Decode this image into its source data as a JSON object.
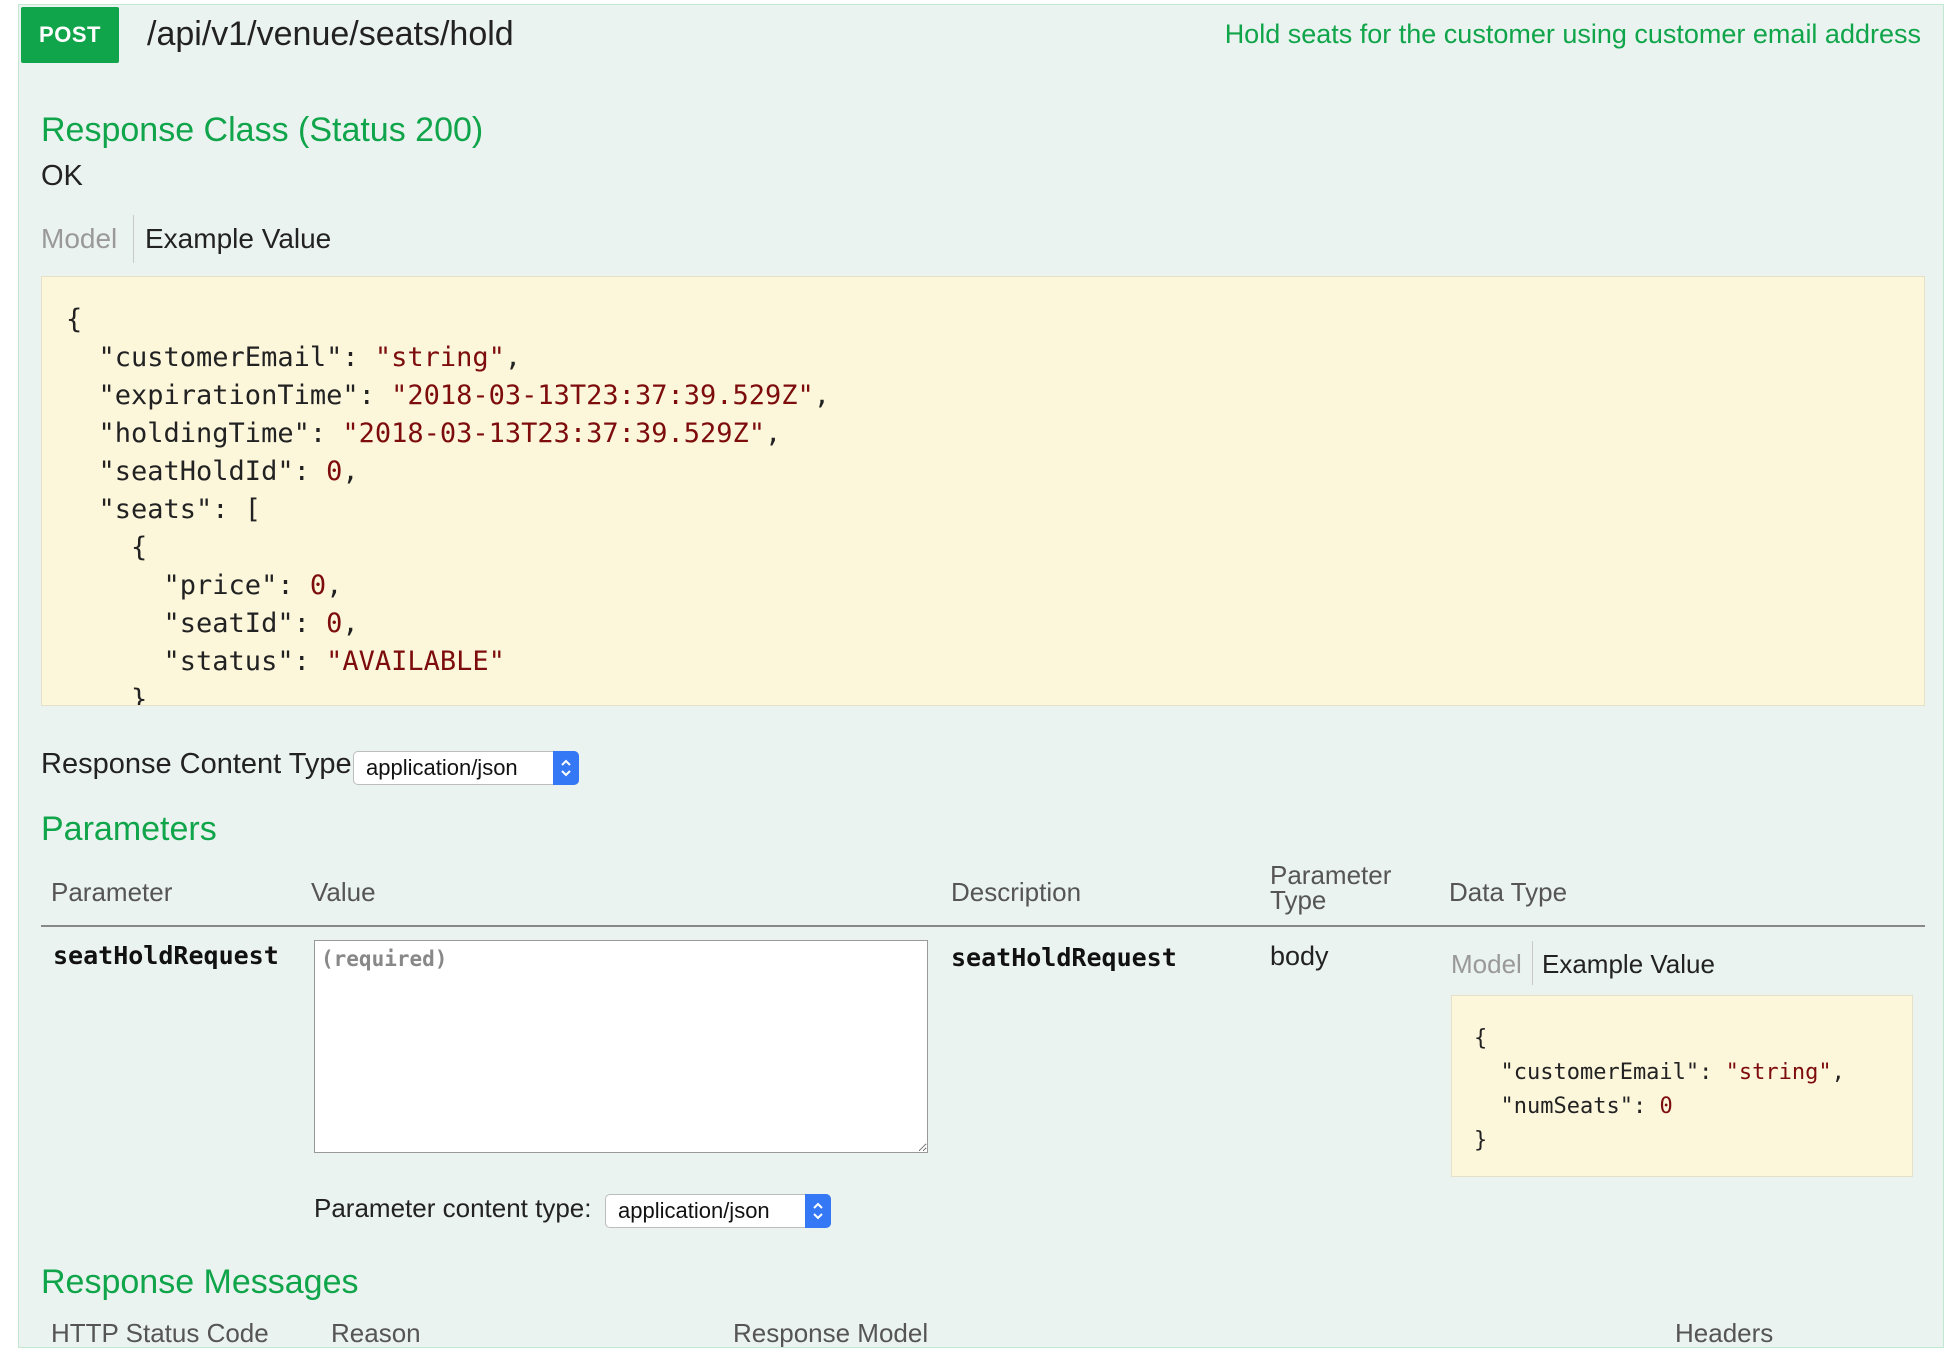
{
  "operation": {
    "method": "POST",
    "path": "/api/v1/venue/seats/hold",
    "summary": "Hold seats for the customer using customer email address"
  },
  "response_class": {
    "heading": "Response Class (Status 200)",
    "status_text": "OK",
    "tabs": {
      "model": "Model",
      "example": "Example Value"
    },
    "example_lines": [
      "{",
      "  \"customerEmail\": \"string\",",
      "  \"expirationTime\": \"2018-03-13T23:37:39.529Z\",",
      "  \"holdingTime\": \"2018-03-13T23:37:39.529Z\",",
      "  \"seatHoldId\": 0,",
      "  \"seats\": [",
      "    {",
      "      \"price\": 0,",
      "      \"seatId\": 0,",
      "      \"status\": \"AVAILABLE\"",
      "    }"
    ]
  },
  "response_content_type": {
    "label": "Response Content Type",
    "selected": "application/json"
  },
  "parameters": {
    "heading": "Parameters",
    "columns": {
      "parameter": "Parameter",
      "value": "Value",
      "description": "Description",
      "param_type": "Parameter\nType",
      "data_type": "Data Type"
    },
    "rows": [
      {
        "name": "seatHoldRequest",
        "placeholder": "(required)",
        "description": "seatHoldRequest",
        "param_type": "body",
        "tabs": {
          "model": "Model",
          "example": "Example Value"
        },
        "example_lines": [
          "{",
          "  \"customerEmail\": \"string\",",
          "  \"numSeats\": 0",
          "}"
        ],
        "content_type_label": "Parameter content type:",
        "content_type_selected": "application/json"
      }
    ]
  },
  "response_messages": {
    "heading": "Response Messages",
    "columns": {
      "code": "HTTP Status Code",
      "reason": "Reason",
      "model": "Response Model",
      "headers": "Headers"
    }
  },
  "colors": {
    "accent_green": "#10a54a",
    "panel_bg": "#ebf3f0",
    "code_bg": "#fcf6db",
    "string_red": "#7d0c0c",
    "select_blue": "#3478f6"
  }
}
